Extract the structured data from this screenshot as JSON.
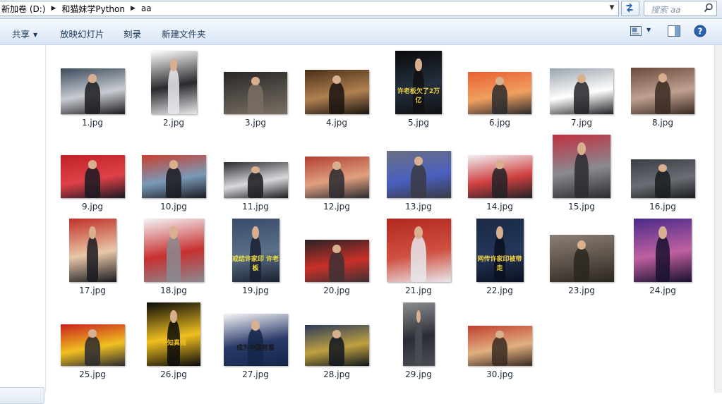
{
  "address": {
    "crumbs": [
      "新加卷 (D:)",
      "和猫妹学Python",
      "aa"
    ]
  },
  "search": {
    "placeholder": "搜索 aa"
  },
  "toolbar": {
    "share": "共享",
    "slideshow": "放映幻灯片",
    "burn": "刻录",
    "new_folder": "新建文件夹"
  },
  "files": [
    {
      "name": "1.jpg",
      "colors": [
        "#3a4a5a",
        "#c9ccd2",
        "#1c1c20"
      ]
    },
    {
      "name": "2.jpg",
      "colors": [
        "#ffffff",
        "#2a2a2e",
        "#e9e9ec"
      ]
    },
    {
      "name": "3.jpg",
      "colors": [
        "#2a2624",
        "#55504a",
        "#7a6e62"
      ]
    },
    {
      "name": "4.jpg",
      "colors": [
        "#4a3018",
        "#b08050",
        "#1a1410"
      ]
    },
    {
      "name": "5.jpg",
      "colors": [
        "#0a0a0c",
        "#24303e",
        "#101012"
      ],
      "caption": "许老板欠了2万亿",
      "caption_color": "#f0d040"
    },
    {
      "name": "6.jpg",
      "colors": [
        "#e86030",
        "#f0a060",
        "#2a2a2e"
      ]
    },
    {
      "name": "7.jpg",
      "colors": [
        "#9aa4ae",
        "#ffffff",
        "#222226"
      ]
    },
    {
      "name": "8.jpg",
      "colors": [
        "#6a4a3a",
        "#c0a090",
        "#3a2a22"
      ]
    },
    {
      "name": "9.jpg",
      "colors": [
        "#c02028",
        "#e04048",
        "#1a1a22"
      ]
    },
    {
      "name": "10.jpg",
      "colors": [
        "#c84030",
        "#7a9ab8",
        "#1a1a20"
      ]
    },
    {
      "name": "11.jpg",
      "colors": [
        "#2a2a30",
        "#d8d8dc",
        "#1a1a1e"
      ]
    },
    {
      "name": "12.jpg",
      "colors": [
        "#b04030",
        "#e0a080",
        "#2a2a30"
      ]
    },
    {
      "name": "13.jpg",
      "colors": [
        "#6a7080",
        "#4a60c0",
        "#3a3a44"
      ]
    },
    {
      "name": "14.jpg",
      "colors": [
        "#f0f0f2",
        "#d04040",
        "#222228"
      ]
    },
    {
      "name": "15.jpg",
      "colors": [
        "#c03040",
        "#8a8a90",
        "#2a2a30"
      ]
    },
    {
      "name": "16.jpg",
      "colors": [
        "#3a3e44",
        "#6a6e74",
        "#1a1c20"
      ]
    },
    {
      "name": "17.jpg",
      "colors": [
        "#c03028",
        "#e8c8a8",
        "#1a1a20"
      ]
    },
    {
      "name": "18.jpg",
      "colors": [
        "#f4f4f6",
        "#c83030",
        "#8a8a90"
      ]
    },
    {
      "name": "19.jpg",
      "colors": [
        "#3a4a6a",
        "#5a7088",
        "#1a2030"
      ],
      "caption": "戒结许家印 许老板",
      "caption_color": "#f0e040"
    },
    {
      "name": "20.jpg",
      "colors": [
        "#2a2226",
        "#c83028",
        "#403034"
      ]
    },
    {
      "name": "21.jpg",
      "colors": [
        "#b02820",
        "#d05040",
        "#e8e8ec"
      ]
    },
    {
      "name": "22.jpg",
      "colors": [
        "#1a2a44",
        "#24365a",
        "#0a1020"
      ],
      "caption": "网传许家印被带走",
      "caption_color": "#f0d040"
    },
    {
      "name": "23.jpg",
      "colors": [
        "#8a8074",
        "#5a5048",
        "#2a2620"
      ]
    },
    {
      "name": "24.jpg",
      "colors": [
        "#4a2a8a",
        "#c060a0",
        "#1a1030"
      ]
    },
    {
      "name": "25.jpg",
      "colors": [
        "#c82020",
        "#f0c020",
        "#2a2a30"
      ]
    },
    {
      "name": "26.jpg",
      "colors": [
        "#0a0a0a",
        "#f0c020",
        "#0a0a0a"
      ],
      "caption": "不知真假",
      "caption_color": "#f0c020"
    },
    {
      "name": "27.jpg",
      "colors": [
        "#f6f6f8",
        "#2a3a6a",
        "#14264a"
      ],
      "caption": "成为中国首富",
      "caption_color": "#1a1a1a"
    },
    {
      "name": "28.jpg",
      "colors": [
        "#2a3a5a",
        "#c0a040",
        "#101820"
      ]
    },
    {
      "name": "29.jpg",
      "colors": [
        "#8a8c90",
        "#2a2e34",
        "#4a4e54"
      ]
    },
    {
      "name": "30.jpg",
      "colors": [
        "#c04030",
        "#e0b080",
        "#3a2a22"
      ]
    }
  ]
}
